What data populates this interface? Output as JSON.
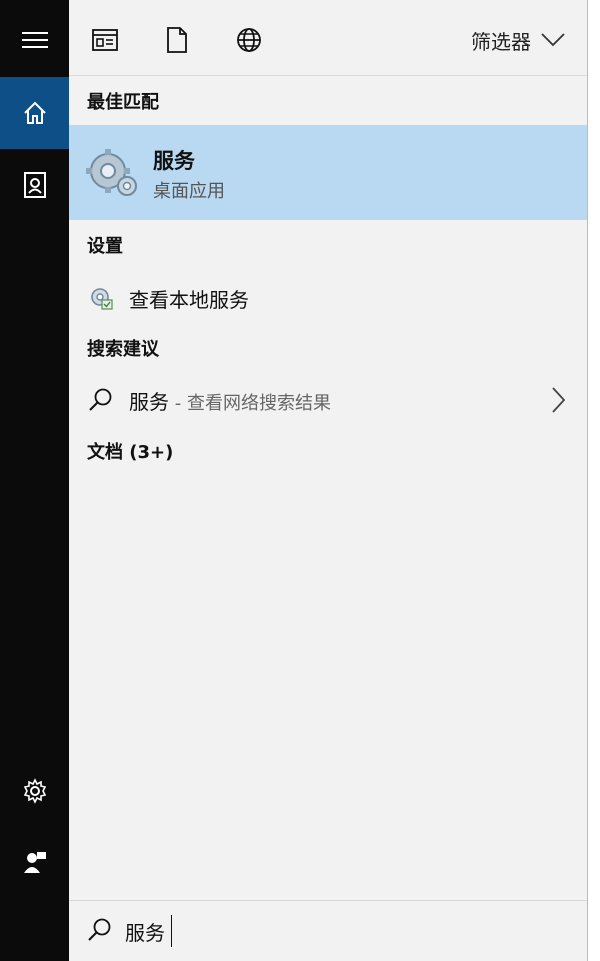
{
  "rail": {
    "items": [
      {
        "id": "menu",
        "icon": "hamburger-menu-icon"
      },
      {
        "id": "home",
        "icon": "home-icon",
        "active": true
      },
      {
        "id": "notebook",
        "icon": "notebook-icon"
      },
      {
        "id": "settings",
        "icon": "gear-icon"
      },
      {
        "id": "user",
        "icon": "user-feedback-icon"
      }
    ]
  },
  "topbar": {
    "icons": [
      "apps-icon",
      "document-icon",
      "globe-icon"
    ],
    "filter_label": "筛选器"
  },
  "sections": {
    "best_match": "最佳匹配",
    "settings": "设置",
    "search_suggestions": "搜索建议",
    "documents": "文档 (3+)"
  },
  "best_match": {
    "title": "服务",
    "subtitle": "桌面应用",
    "icon": "services-gear-icon"
  },
  "settings_item": {
    "label": "查看本地服务",
    "icon": "settings-gear-icon"
  },
  "suggestion": {
    "term": "服务",
    "hint": " - 查看网络搜索结果",
    "icon": "search-icon"
  },
  "search": {
    "value": "服务",
    "icon": "search-icon"
  },
  "colors": {
    "rail": "#0b0b0b",
    "rail_active": "#0d4f86",
    "panel": "#f2f2f2",
    "highlight": "#b9d9f2"
  }
}
